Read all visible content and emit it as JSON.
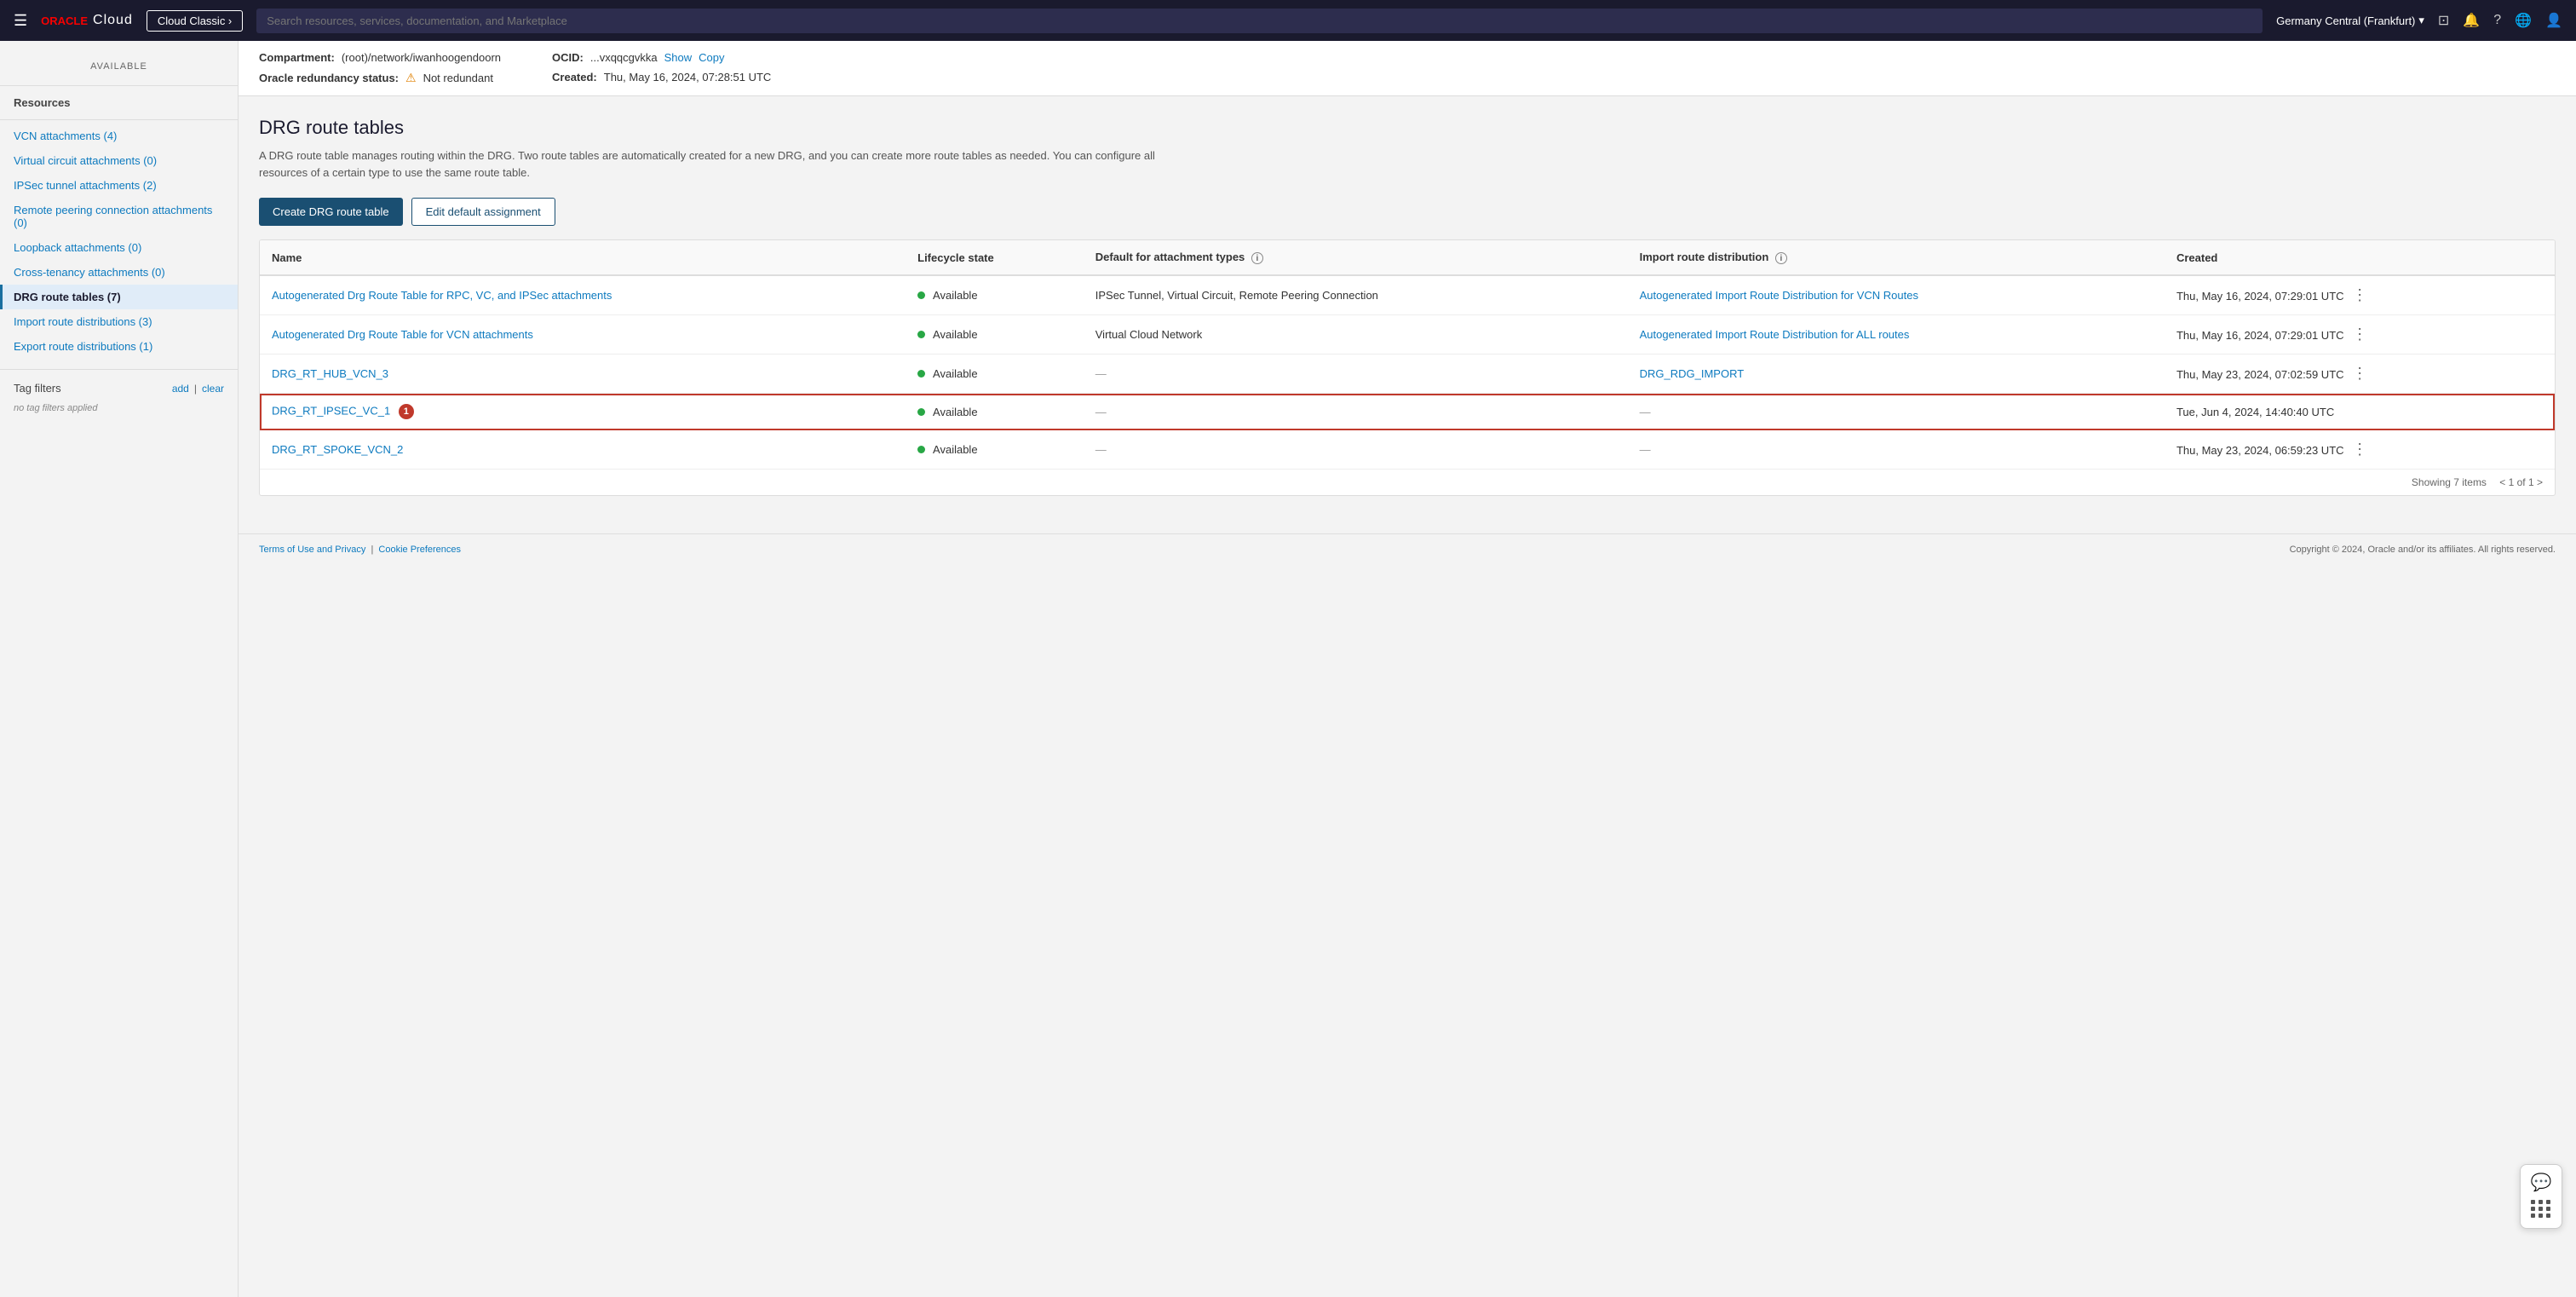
{
  "nav": {
    "hamburger": "☰",
    "logo_oracle": "ORACLE",
    "logo_cloud": "Cloud",
    "cloud_classic_btn": "Cloud Classic ›",
    "search_placeholder": "Search resources, services, documentation, and Marketplace",
    "region": "Germany Central (Frankfurt)",
    "region_chevron": "▾"
  },
  "sidebar": {
    "available_label": "AVAILABLE",
    "resources_label": "Resources",
    "items": [
      {
        "id": "vcn-attachments",
        "label": "VCN attachments (4)",
        "active": false
      },
      {
        "id": "virtual-circuit-attachments",
        "label": "Virtual circuit attachments (0)",
        "active": false
      },
      {
        "id": "ipsec-tunnel-attachments",
        "label": "IPSec tunnel attachments (2)",
        "active": false
      },
      {
        "id": "remote-peering-attachments",
        "label": "Remote peering connection attachments (0)",
        "active": false
      },
      {
        "id": "loopback-attachments",
        "label": "Loopback attachments (0)",
        "active": false
      },
      {
        "id": "cross-tenancy-attachments",
        "label": "Cross-tenancy attachments (0)",
        "active": false
      },
      {
        "id": "drg-route-tables",
        "label": "DRG route tables (7)",
        "active": true
      },
      {
        "id": "import-route-distributions",
        "label": "Import route distributions (3)",
        "active": false
      },
      {
        "id": "export-route-distributions",
        "label": "Export route distributions (1)",
        "active": false
      }
    ],
    "tag_filters_label": "Tag filters",
    "tag_add": "add",
    "tag_separator": "|",
    "tag_clear": "clear",
    "no_filters": "no tag filters applied"
  },
  "info_bar": {
    "compartment_label": "Compartment:",
    "compartment_value": "(root)/network/iwanhoogendoorn",
    "ocid_label": "OCID:",
    "ocid_value": "...vxqqcgvkka",
    "ocid_show": "Show",
    "ocid_copy": "Copy",
    "redundancy_label": "Oracle redundancy status:",
    "redundancy_icon": "⚠",
    "redundancy_value": "Not redundant",
    "created_label": "Created:",
    "created_value": "Thu, May 16, 2024, 07:28:51 UTC"
  },
  "page": {
    "title": "DRG route tables",
    "description": "A DRG route table manages routing within the DRG. Two route tables are automatically created for a new DRG, and you can create more route tables as needed. You can configure all resources of a certain type to use the same route table.",
    "create_btn": "Create DRG route table",
    "edit_btn": "Edit default assignment"
  },
  "table": {
    "columns": [
      {
        "id": "name",
        "label": "Name",
        "info": false
      },
      {
        "id": "lifecycle",
        "label": "Lifecycle state",
        "info": false
      },
      {
        "id": "default-attachment",
        "label": "Default for attachment types",
        "info": true
      },
      {
        "id": "import-route",
        "label": "Import route distribution",
        "info": true
      },
      {
        "id": "created",
        "label": "Created",
        "info": false
      }
    ],
    "rows": [
      {
        "id": "row1",
        "name": "Autogenerated Drg Route Table for RPC, VC, and IPSec attachments",
        "name_link": true,
        "lifecycle": "Available",
        "default_attachment": "IPSec Tunnel, Virtual Circuit, Remote Peering Connection",
        "import_route": "Autogenerated Import Route Distribution for VCN Routes",
        "import_route_link": true,
        "created": "Thu, May 16, 2024, 07:29:01 UTC",
        "menu": true,
        "highlighted": false
      },
      {
        "id": "row2",
        "name": "Autogenerated Drg Route Table for VCN attachments",
        "name_link": true,
        "lifecycle": "Available",
        "default_attachment": "Virtual Cloud Network",
        "import_route": "Autogenerated Import Route Distribution for ALL routes",
        "import_route_link": true,
        "created": "Thu, May 16, 2024, 07:29:01 UTC",
        "menu": true,
        "highlighted": false
      },
      {
        "id": "row3",
        "name": "DRG_RT_HUB_VCN_3",
        "name_link": true,
        "lifecycle": "Available",
        "default_attachment": "—",
        "import_route": "DRG_RDG_IMPORT",
        "import_route_link": true,
        "created": "Thu, May 23, 2024, 07:02:59 UTC",
        "menu": true,
        "highlighted": false
      },
      {
        "id": "row4",
        "name": "DRG_RT_IPSEC_VC_1",
        "name_link": true,
        "lifecycle": "Available",
        "default_attachment": "—",
        "import_route": "—",
        "import_route_link": false,
        "created": "Tue, Jun 4, 2024, 14:40:40 UTC",
        "menu": false,
        "highlighted": true,
        "badge": "1"
      },
      {
        "id": "row5",
        "name": "DRG_RT_SPOKE_VCN_2",
        "name_link": true,
        "lifecycle": "Available",
        "default_attachment": "—",
        "import_route": "—",
        "import_route_link": false,
        "created": "Thu, May 23, 2024, 06:59:23 UTC",
        "menu": true,
        "highlighted": false
      }
    ],
    "showing": "Showing 7 items",
    "pagination": "< 1 of 1 >"
  },
  "footer": {
    "left": "Terms of Use and Privacy",
    "right": "Copyright © 2024, Oracle and/or its affiliates. All rights reserved.",
    "cookie": "Cookie Preferences"
  }
}
